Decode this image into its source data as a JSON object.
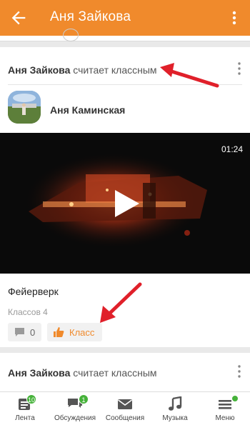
{
  "header": {
    "title": "Аня Зайкова",
    "back_icon": "arrow-left-icon",
    "menu_icon": "more-vert-icon",
    "color": "#f08a2c"
  },
  "post": {
    "actor_name": "Аня Зайкова",
    "verb": "считает классным",
    "author_name": "Аня Каминская",
    "video_duration": "01:24",
    "video_title": "Фейерверк",
    "likes_text": "Классов 4",
    "comment_count": "0",
    "class_label": "Класс"
  },
  "post2": {
    "actor_name": "Аня Зайкова",
    "verb": "считает классным"
  },
  "nav": {
    "items": [
      {
        "label": "Лента",
        "icon": "feed-icon",
        "badge": "10"
      },
      {
        "label": "Обсуждения",
        "icon": "discussions-icon",
        "badge": "1"
      },
      {
        "label": "Сообщения",
        "icon": "mail-icon"
      },
      {
        "label": "Музыка",
        "icon": "music-icon"
      },
      {
        "label": "Меню",
        "icon": "hamburger-menu-icon"
      }
    ]
  },
  "annotation_color": "#e0202a"
}
